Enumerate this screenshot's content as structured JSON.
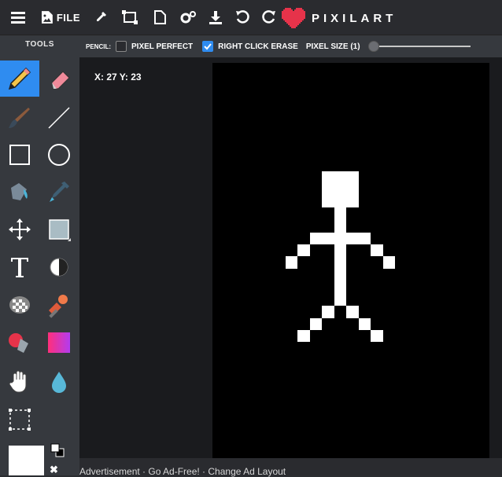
{
  "toolbar": {
    "menu_icon": "hamburger-icon",
    "file_label": "FILE",
    "brand_text": "PIXILART"
  },
  "sidebar": {
    "title": "TOOLS"
  },
  "options": {
    "tool_name": "PENCIL:",
    "pixel_perfect_label": "PIXEL PERFECT",
    "pixel_perfect_checked": false,
    "right_click_erase_label": "RIGHT CLICK ERASE",
    "right_click_erase_checked": true,
    "pixel_size_label": "PIXEL SIZE (1)",
    "pixel_size_value": 1
  },
  "workspace": {
    "coords": "X: 27 Y: 23"
  },
  "ad": {
    "text": "Advertisement · Go Ad-Free! · Change Ad Layout",
    "close": "✖"
  },
  "colors": {
    "accent": "#2f8cf0",
    "brand_heart": "#e6334a",
    "canvas_bg": "#000000",
    "stroke": "#ffffff"
  }
}
